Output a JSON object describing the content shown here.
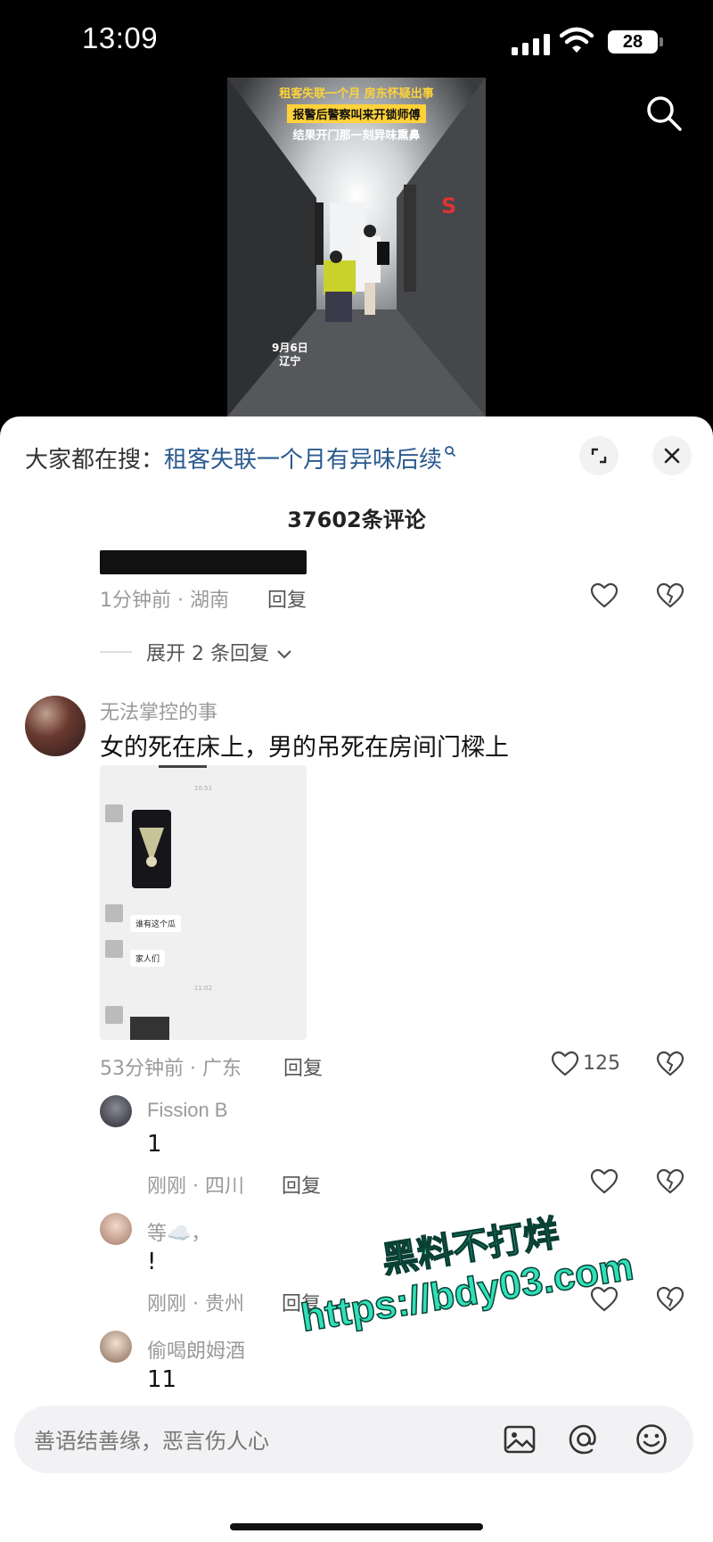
{
  "status_bar": {
    "time": "13:09",
    "battery": "28"
  },
  "video": {
    "caption_line1": "租客失联一个月 房东怀疑出事",
    "caption_line2": "报警后警察叫来开锁师傅",
    "caption_line3": "结果开门那一刻异味熏鼻",
    "date_line1": "9月6日",
    "date_line2": "辽宁"
  },
  "comments_panel": {
    "hot_search_prefix": "大家都在搜：",
    "hot_search_link": "租客失联一个月有异味后续",
    "comment_count": "37602条评论",
    "top_comment": {
      "time_location": "1分钟前 · 湖南",
      "reply_label": "回复"
    },
    "expand_replies": "展开 2 条回复",
    "main_comment": {
      "username": "无法掌控的事",
      "text": "女的死在床上，男的吊死在房间门樑上",
      "time_location": "53分钟前 · 广东",
      "reply_label": "回复",
      "like_count": "125",
      "image_chat": {
        "time1": "10:51",
        "bubble1": "谁有这个瓜",
        "bubble2": "家人们",
        "time2": "11:02"
      }
    },
    "replies": [
      {
        "username": "Fission B",
        "text": "1",
        "time_location": "刚刚 · 四川",
        "reply_label": "回复"
      },
      {
        "username": "等☁️，",
        "text": "!",
        "time_location": "刚刚 · 贵州",
        "reply_label": "回复"
      },
      {
        "username": "偷喝朗姆酒",
        "text": "11"
      }
    ]
  },
  "watermark": {
    "line1": "黑料不打烊",
    "line2": "https://bdy03.com"
  },
  "input": {
    "placeholder": "善语结善缘，恶言伤人心"
  },
  "colors": {
    "link": "#2a5a8f",
    "watermark": "#2fe0b8",
    "video_caption": "#ffd23a"
  }
}
